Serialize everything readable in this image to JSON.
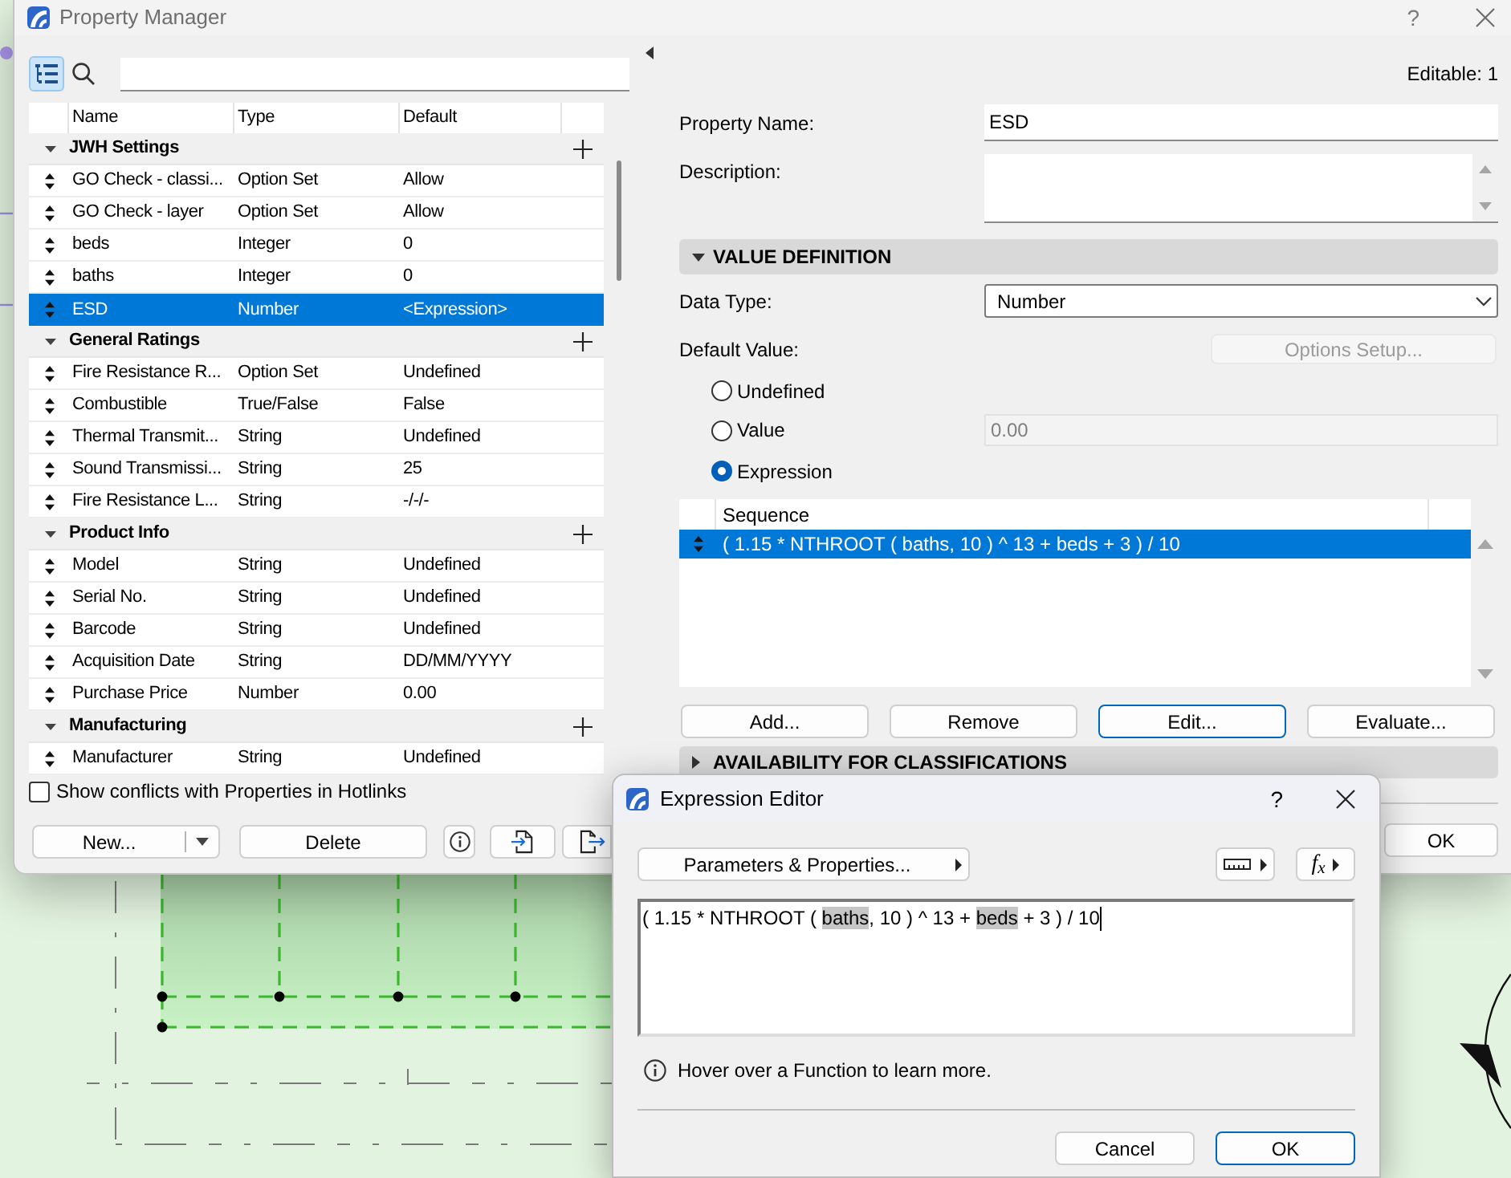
{
  "property_manager": {
    "title": "Property Manager",
    "help": "?",
    "tree_view_button": {
      "selected": true
    },
    "columns": [
      "Name",
      "Type",
      "Default"
    ],
    "groups": [
      {
        "name": "JWH Settings",
        "expanded": true,
        "rows": [
          {
            "name": "GO Check - classi...",
            "type": "Option Set",
            "default": "Allow",
            "selected": false
          },
          {
            "name": "GO Check - layer",
            "type": "Option Set",
            "default": "Allow",
            "selected": false
          },
          {
            "name": "beds",
            "type": "Integer",
            "default": "0",
            "selected": false
          },
          {
            "name": "baths",
            "type": "Integer",
            "default": "0",
            "selected": false
          },
          {
            "name": "ESD",
            "type": "Number",
            "default": "<Expression>",
            "selected": true
          }
        ]
      },
      {
        "name": "General Ratings",
        "expanded": true,
        "rows": [
          {
            "name": "Fire Resistance R...",
            "type": "Option Set",
            "default": "Undefined",
            "selected": false
          },
          {
            "name": "Combustible",
            "type": "True/False",
            "default": "False",
            "selected": false
          },
          {
            "name": "Thermal Transmit...",
            "type": "String",
            "default": "Undefined",
            "selected": false
          },
          {
            "name": "Sound Transmissi...",
            "type": "String",
            "default": "25",
            "selected": false
          },
          {
            "name": "Fire Resistance L...",
            "type": "String",
            "default": "-/-/-",
            "selected": false
          }
        ]
      },
      {
        "name": "Product Info",
        "expanded": true,
        "rows": [
          {
            "name": "Model",
            "type": "String",
            "default": "Undefined",
            "selected": false
          },
          {
            "name": "Serial No.",
            "type": "String",
            "default": "Undefined",
            "selected": false
          },
          {
            "name": "Barcode",
            "type": "String",
            "default": "Undefined",
            "selected": false
          },
          {
            "name": "Acquisition Date",
            "type": "String",
            "default": "DD/MM/YYYY",
            "selected": false
          },
          {
            "name": "Purchase Price",
            "type": "Number",
            "default": "0.00",
            "selected": false
          }
        ]
      },
      {
        "name": "Manufacturing",
        "expanded": true,
        "rows": [
          {
            "name": "Manufacturer",
            "type": "String",
            "default": "Undefined",
            "selected": false
          }
        ]
      }
    ],
    "show_conflicts": {
      "label": "Show conflicts with Properties in Hotlinks",
      "checked": false
    },
    "new_button": "New...",
    "delete_button": "Delete"
  },
  "details": {
    "editable": "Editable: 1",
    "property_name": {
      "label": "Property Name:",
      "value": "ESD"
    },
    "description": {
      "label": "Description:"
    },
    "value_definition": {
      "title": "VALUE DEFINITION",
      "expanded": true
    },
    "data_type": {
      "label": "Data Type:",
      "value": "Number"
    },
    "default_value": {
      "label": "Default Value:",
      "options_setup": {
        "label": "Options Setup...",
        "disabled": true
      },
      "options": [
        {
          "label": "Undefined",
          "selected": false
        },
        {
          "label": "Value",
          "selected": false
        },
        {
          "label": "Expression",
          "selected": true
        }
      ],
      "value_field": {
        "value": "0.00",
        "disabled": true
      }
    },
    "sequence": {
      "column": "Sequence",
      "rows": [
        {
          "expression": "( 1.15 * NTHROOT ( baths, 10 ) ^ 13 + beds + 3 ) / 10",
          "selected": true
        }
      ]
    },
    "buttons": [
      {
        "label": "Add...",
        "focused": false
      },
      {
        "label": "Remove",
        "focused": false
      },
      {
        "label": "Edit...",
        "focused": true
      },
      {
        "label": "Evaluate...",
        "focused": false
      }
    ],
    "availability": {
      "title": "AVAILABILITY FOR CLASSIFICATIONS",
      "expanded": false
    },
    "ok_button": "OK"
  },
  "expression_editor": {
    "title": "Expression Editor",
    "help": "?",
    "parameters_button": "Parameters & Properties...",
    "function_button": "f$_{x}$",
    "expression": [
      {
        "text": "( 1.15 * NTHROOT ( ",
        "highlighted": false
      },
      {
        "text": "baths",
        "highlighted": true
      },
      {
        "text": ", 10 ) ^ 13 + ",
        "highlighted": false
      },
      {
        "text": "beds",
        "highlighted": true
      },
      {
        "text": " + 3 ) / 10",
        "highlighted": false
      }
    ],
    "hint": "Hover over a Function to learn more.",
    "buttons": [
      {
        "label": "Cancel",
        "default": false
      },
      {
        "label": "OK",
        "default": true
      }
    ]
  }
}
